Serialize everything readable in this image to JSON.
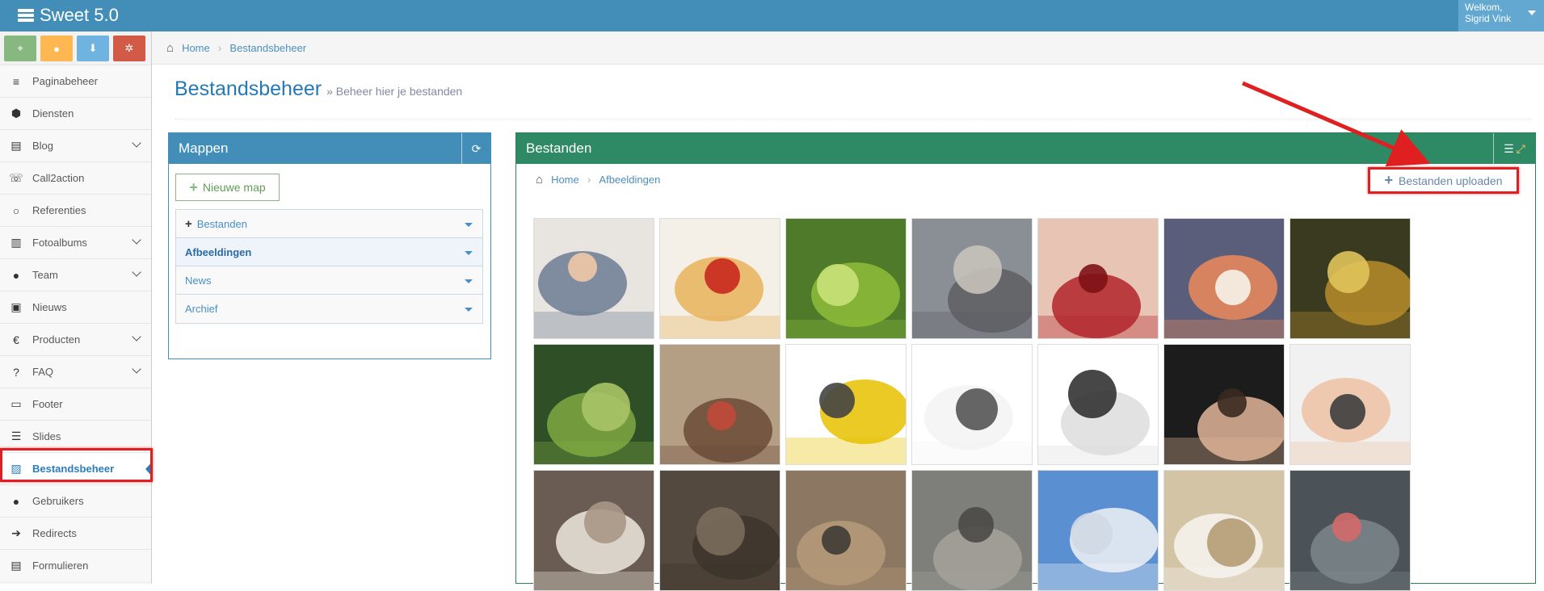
{
  "app": {
    "title": "Sweet 5.0"
  },
  "user": {
    "line1": "Welkom,",
    "line2": "Sigrid Vink"
  },
  "shortcuts": [
    {
      "icon": "map-marker-icon",
      "color": "#87b87f"
    },
    {
      "icon": "user-icon",
      "color": "#ffb752"
    },
    {
      "icon": "download-icon",
      "color": "#6fb3e0"
    },
    {
      "icon": "cogs-icon",
      "color": "#d15b47"
    }
  ],
  "sidebar": {
    "items": [
      {
        "label": "Paginabeheer",
        "icon": "bars-icon",
        "glyph": "≡",
        "submenu": false
      },
      {
        "label": "Diensten",
        "icon": "cubes-icon",
        "glyph": "⬢",
        "submenu": false
      },
      {
        "label": "Blog",
        "icon": "file-text-icon",
        "glyph": "▤",
        "submenu": true
      },
      {
        "label": "Call2action",
        "icon": "volume-control-phone-icon",
        "glyph": "☏",
        "submenu": false
      },
      {
        "label": "Referenties",
        "icon": "comment-icon",
        "glyph": "○",
        "submenu": false
      },
      {
        "label": "Fotoalbums",
        "icon": "book-icon",
        "glyph": "▥",
        "submenu": true
      },
      {
        "label": "Team",
        "icon": "users-icon",
        "glyph": "●",
        "submenu": true
      },
      {
        "label": "Nieuws",
        "icon": "newspaper-icon",
        "glyph": "▣",
        "submenu": false
      },
      {
        "label": "Producten",
        "icon": "euro-icon",
        "glyph": "€",
        "submenu": true
      },
      {
        "label": "FAQ",
        "icon": "question-circle-icon",
        "glyph": "?",
        "submenu": true
      },
      {
        "label": "Footer",
        "icon": "list-alt-icon",
        "glyph": "▭",
        "submenu": false
      },
      {
        "label": "Slides",
        "icon": "sliders-icon",
        "glyph": "☰",
        "submenu": false
      },
      {
        "label": "Bestandsbeheer",
        "icon": "picture-icon",
        "glyph": "▨",
        "submenu": false,
        "active": true
      },
      {
        "label": "Gebruikers",
        "icon": "user-icon",
        "glyph": "●",
        "submenu": false
      },
      {
        "label": "Redirects",
        "icon": "arrow-circle-right-icon",
        "glyph": "➔",
        "submenu": false
      },
      {
        "label": "Formulieren",
        "icon": "list-alt-icon",
        "glyph": "▤",
        "submenu": false
      }
    ]
  },
  "breadcrumb": {
    "home": "Home",
    "current": "Bestandsbeheer"
  },
  "page": {
    "title": "Bestandsbeheer",
    "subtitle": "» Beheer hier je bestanden"
  },
  "mappen": {
    "title": "Mappen",
    "new_folder_label": "Nieuwe map",
    "folders": [
      {
        "label": "Bestanden",
        "plus": true
      },
      {
        "label": "Afbeeldingen",
        "selected": true
      },
      {
        "label": "News"
      },
      {
        "label": "Archief"
      }
    ]
  },
  "bestanden": {
    "title": "Bestanden",
    "crumb_home": "Home",
    "crumb_current": "Afbeeldingen",
    "upload_label": "Bestanden uploaden",
    "images": [
      "portrait-man-plaid-shirt",
      "pasta-tomato-basil",
      "rice-terraces-green",
      "miniature-people-street",
      "miniature-people-fruit",
      "miniature-people-sushi",
      "rice-terraces-golden",
      "mountain-valley",
      "mousetrap",
      "yellow-line-drawing",
      "wine-glass-sketch",
      "building-facade-sketch",
      "man-portrait",
      "surprised-woman",
      "grumpy-cat",
      "monkey-face",
      "cougar",
      "wild-cat",
      "baby-seal-snow",
      "white-puppy-smile",
      "seal-open-mouth"
    ]
  },
  "colors": {
    "topbar": "#438eb9",
    "accent": "#2b7dbc",
    "green_box": "#2e8965",
    "highlight": "#e02020"
  }
}
